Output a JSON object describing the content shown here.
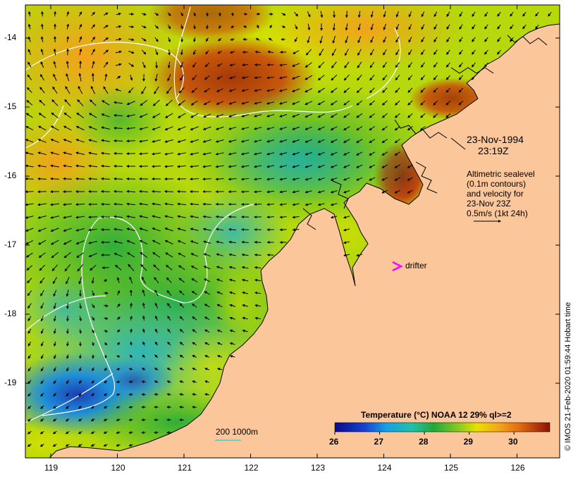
{
  "map": {
    "lon_range": [
      118.65,
      126.7
    ],
    "lat_range": [
      -19.0,
      -13.6
    ],
    "lon_ticks": [
      "119",
      "120",
      "121",
      "122",
      "123",
      "124",
      "125",
      "126"
    ],
    "lat_ticks": [
      "-14",
      "-15",
      "-16",
      "-17",
      "-18",
      "-19"
    ],
    "land_color": "#fbc699",
    "coastline_color": "#000000",
    "contour_color": "#ffffff",
    "vector_color": "#000000"
  },
  "annotations": {
    "date": "23-Nov-1994",
    "time": "23:19Z",
    "sealevel_lines": [
      "Altimetric sealevel",
      "(0.1m contours)",
      "and velocity for",
      "23-Nov 23Z",
      "0.5m/s (1kt 24h)"
    ],
    "drifter_label": "drifter",
    "drifter_color": "#ff00ff",
    "depth_legend": "200  1000m"
  },
  "colorbar": {
    "title": "Temperature (°C) NOAA 12 29% ql>=2",
    "ticks": [
      "26",
      "27",
      "28",
      "29",
      "30"
    ],
    "tick_values": [
      26,
      27,
      28,
      29,
      30
    ],
    "range": [
      26,
      30.8
    ]
  },
  "credit": "© IMOS 21-Feb-2020 01:59:44 Hobart time"
}
